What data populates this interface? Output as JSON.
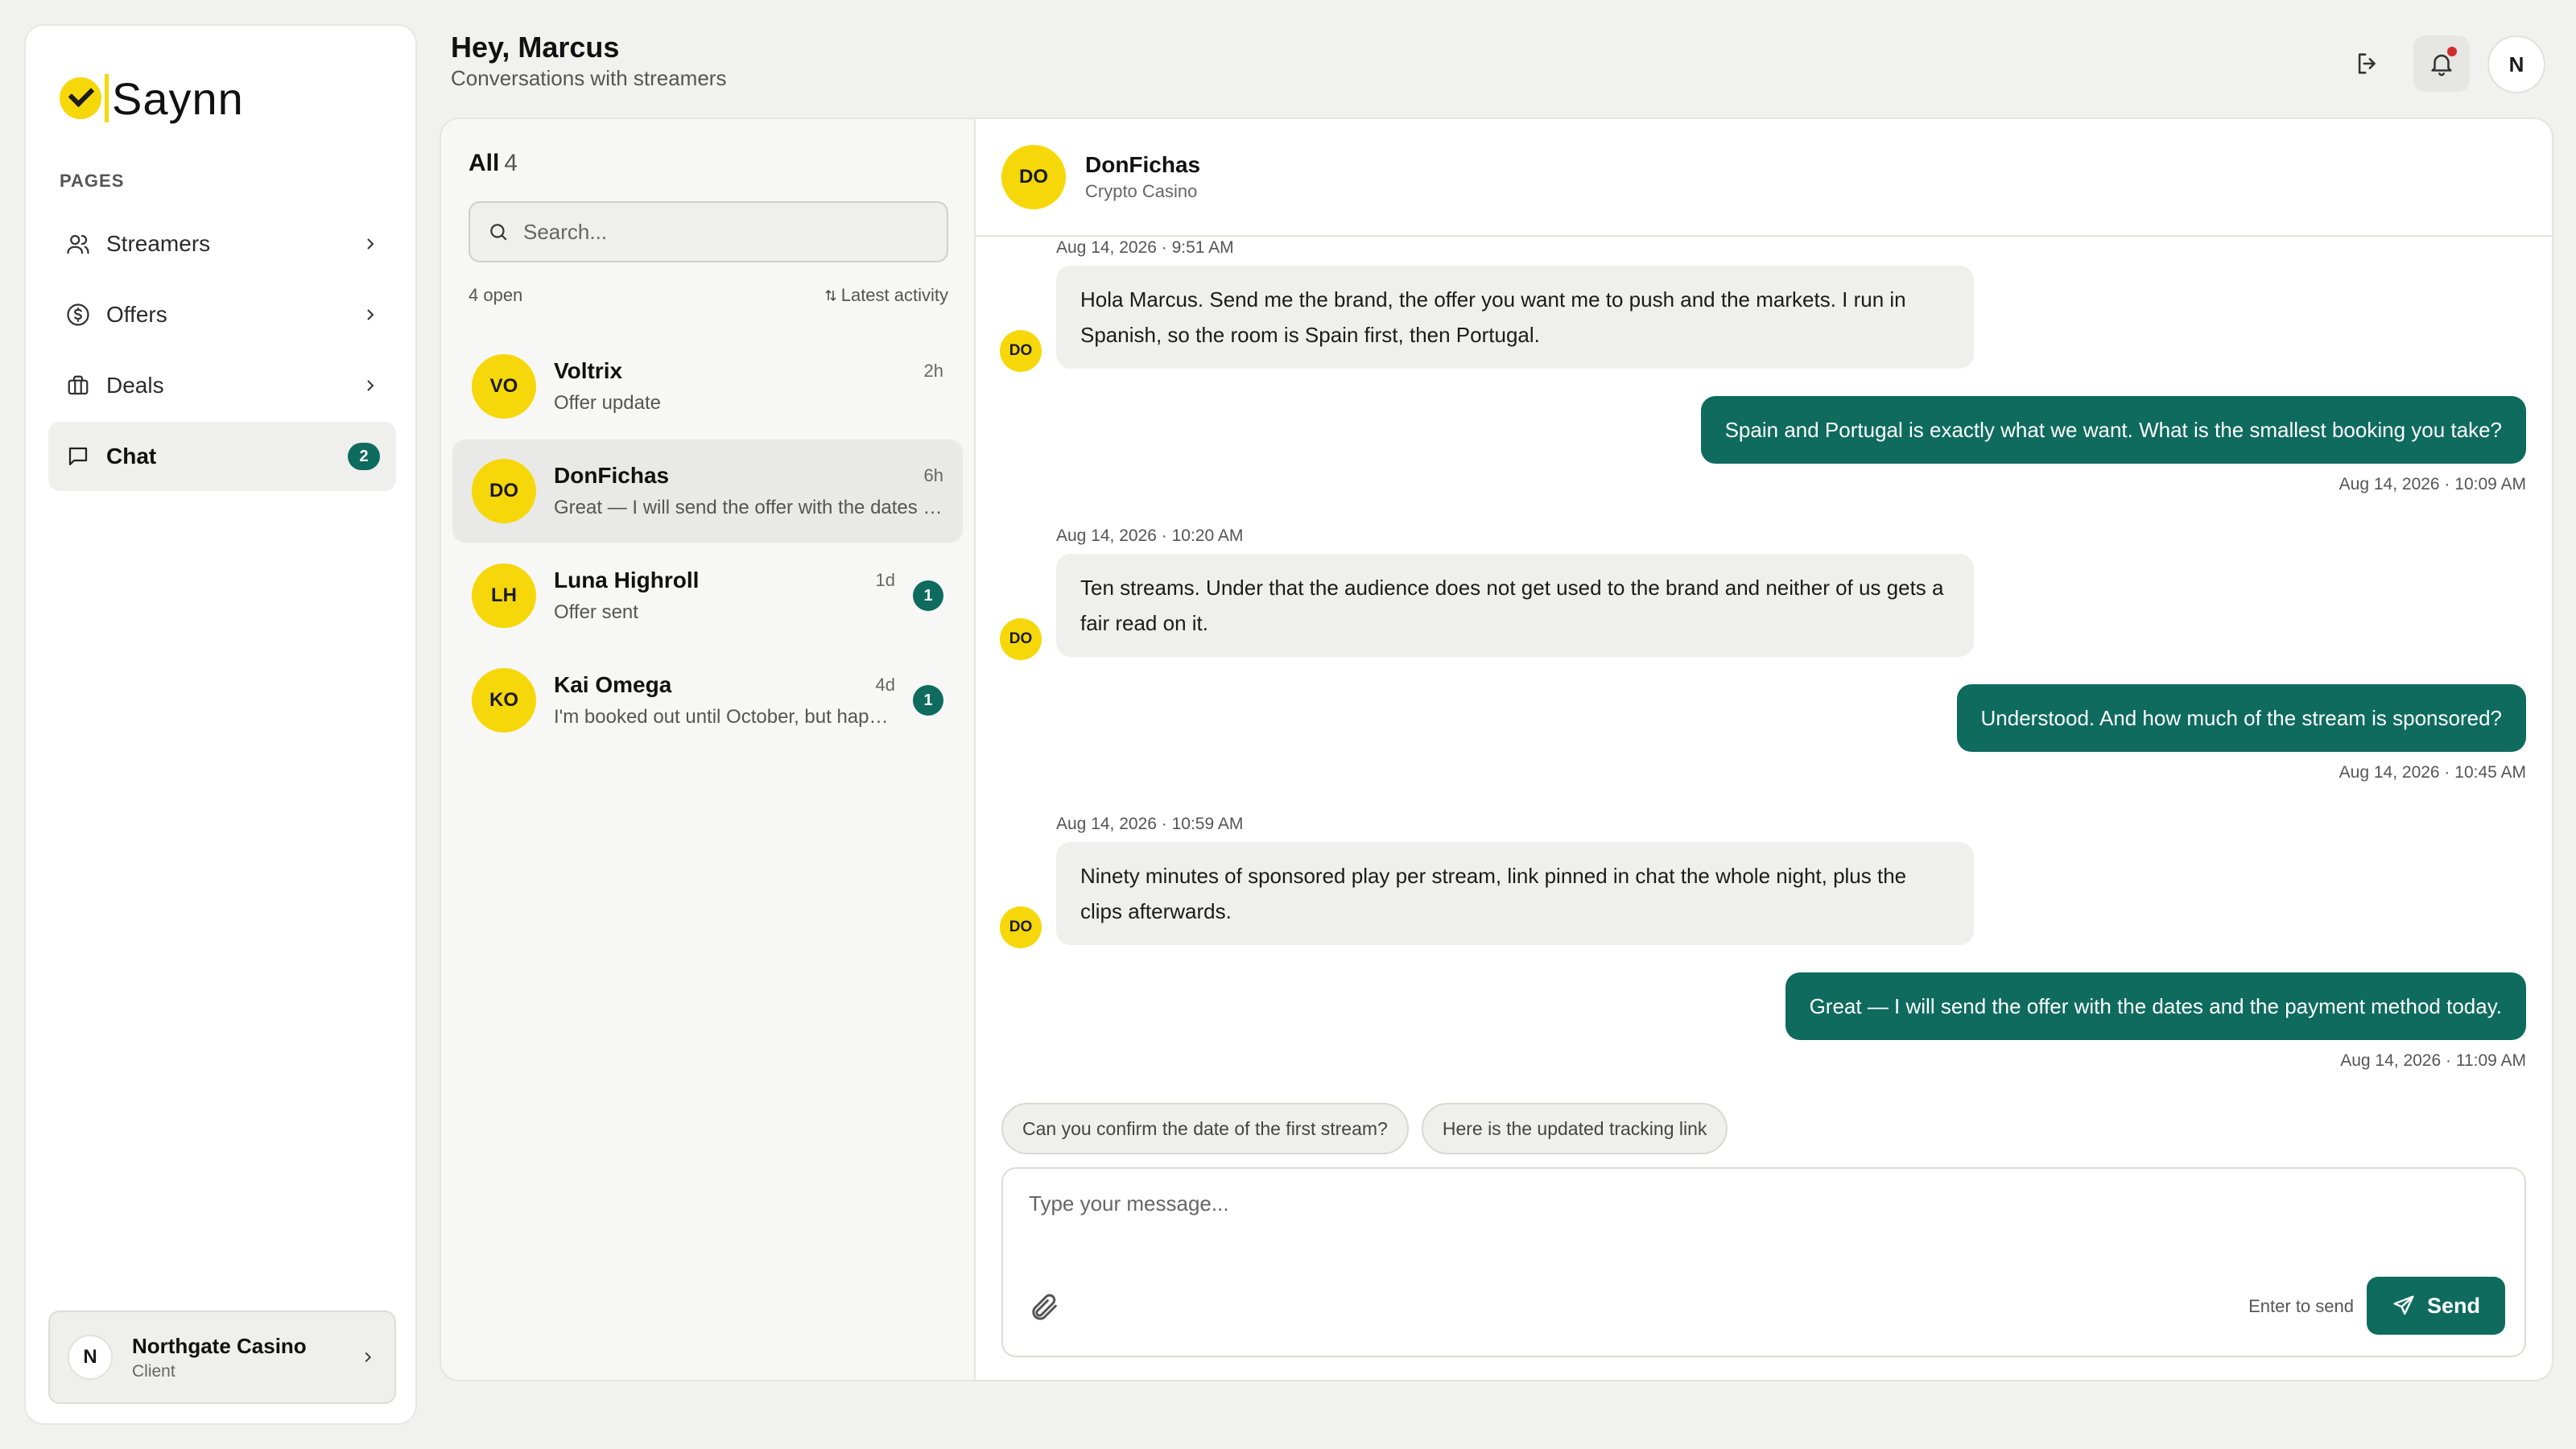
{
  "brand": {
    "name": "Saynn"
  },
  "sidebar": {
    "section_label": "PAGES",
    "items": [
      {
        "label": "Streamers",
        "icon": "users-icon"
      },
      {
        "label": "Offers",
        "icon": "dollar-circle-icon"
      },
      {
        "label": "Deals",
        "icon": "briefcase-icon"
      },
      {
        "label": "Chat",
        "icon": "chat-bubble-icon",
        "badge": "2",
        "active": true
      }
    ],
    "account": {
      "initial": "N",
      "name": "Northgate Casino",
      "role": "Client"
    }
  },
  "header": {
    "greeting": "Hey, Marcus",
    "subtitle": "Conversations with streamers",
    "avatar_initial": "N"
  },
  "conversations": {
    "title": "All",
    "count": "4",
    "search_placeholder": "Search...",
    "open_label": "4 open",
    "sort_label": "Latest activity",
    "items": [
      {
        "initials": "VO",
        "name": "Voltrix",
        "time": "2h",
        "preview": "Offer update",
        "unread": ""
      },
      {
        "initials": "DO",
        "name": "DonFichas",
        "time": "6h",
        "preview": "Great — I will send the offer with the dates and the payment method today.",
        "unread": "",
        "active": true
      },
      {
        "initials": "LH",
        "name": "Luna Highroll",
        "time": "1d",
        "preview": "Offer sent",
        "unread": "1"
      },
      {
        "initials": "KO",
        "name": "Kai Omega",
        "time": "4d",
        "preview": "I'm booked out until October, but happy to talk then.",
        "unread": "1"
      }
    ]
  },
  "chat": {
    "contact": {
      "initials": "DO",
      "name": "DonFichas",
      "subtitle": "Crypto Casino"
    },
    "messages": [
      {
        "dir": "in",
        "time": "Aug 14, 2026 · 9:51 AM",
        "text": "Hola Marcus. Send me the brand, the offer you want me to push and the markets. I run in Spanish, so the room is Spain first, then Portugal."
      },
      {
        "dir": "out",
        "time": "Aug 14, 2026 · 10:09 AM",
        "text": "Spain and Portugal is exactly what we want. What is the smallest booking you take?"
      },
      {
        "dir": "in",
        "time": "Aug 14, 2026 · 10:20 AM",
        "text": "Ten streams. Under that the audience does not get used to the brand and neither of us gets a fair read on it."
      },
      {
        "dir": "out",
        "time": "Aug 14, 2026 · 10:45 AM",
        "text": "Understood. And how much of the stream is sponsored?"
      },
      {
        "dir": "in",
        "time": "Aug 14, 2026 · 10:59 AM",
        "text": "Ninety minutes of sponsored play per stream, link pinned in chat the whole night, plus the clips afterwards."
      },
      {
        "dir": "out",
        "time": "Aug 14, 2026 · 11:09 AM",
        "text": "Great — I will send the offer with the dates and the payment method today."
      }
    ],
    "quick_replies": [
      "Can you confirm the date of the first stream?",
      "Here is the updated tracking link"
    ],
    "composer": {
      "placeholder": "Type your message...",
      "hint": "Enter to send",
      "send_label": "Send"
    }
  },
  "colors": {
    "accent_teal": "#0e6b5e",
    "avatar_yellow": "#f6d80a",
    "notification_dot": "#d12b2b"
  }
}
